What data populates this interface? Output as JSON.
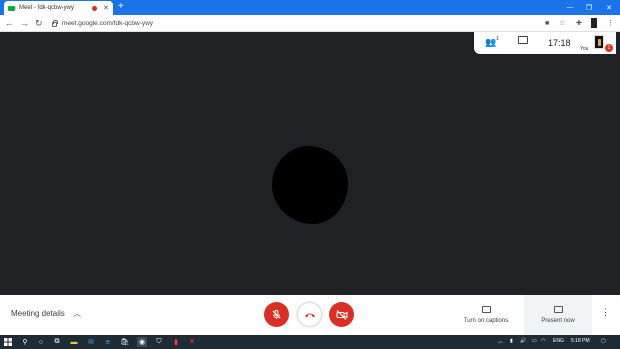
{
  "browser": {
    "tab_title": "Meet - fdk-qcbw-ywy",
    "new_tab_label": "+",
    "url": "meet.google.com/fdk-qcbw-ywy",
    "window_controls": {
      "minimize": "—",
      "maximize": "❐",
      "close": "✕"
    }
  },
  "meeting": {
    "people_count": "1",
    "clock": "17:18",
    "self_label": "You",
    "notification_count": "1",
    "details_label": "Meeting details",
    "captions_label": "Turn on captions",
    "present_label": "Present now",
    "hangup_color": "#d93025",
    "stage_color": "#202124"
  },
  "taskbar": {
    "language": "ENG",
    "time": "5:18 PM"
  }
}
